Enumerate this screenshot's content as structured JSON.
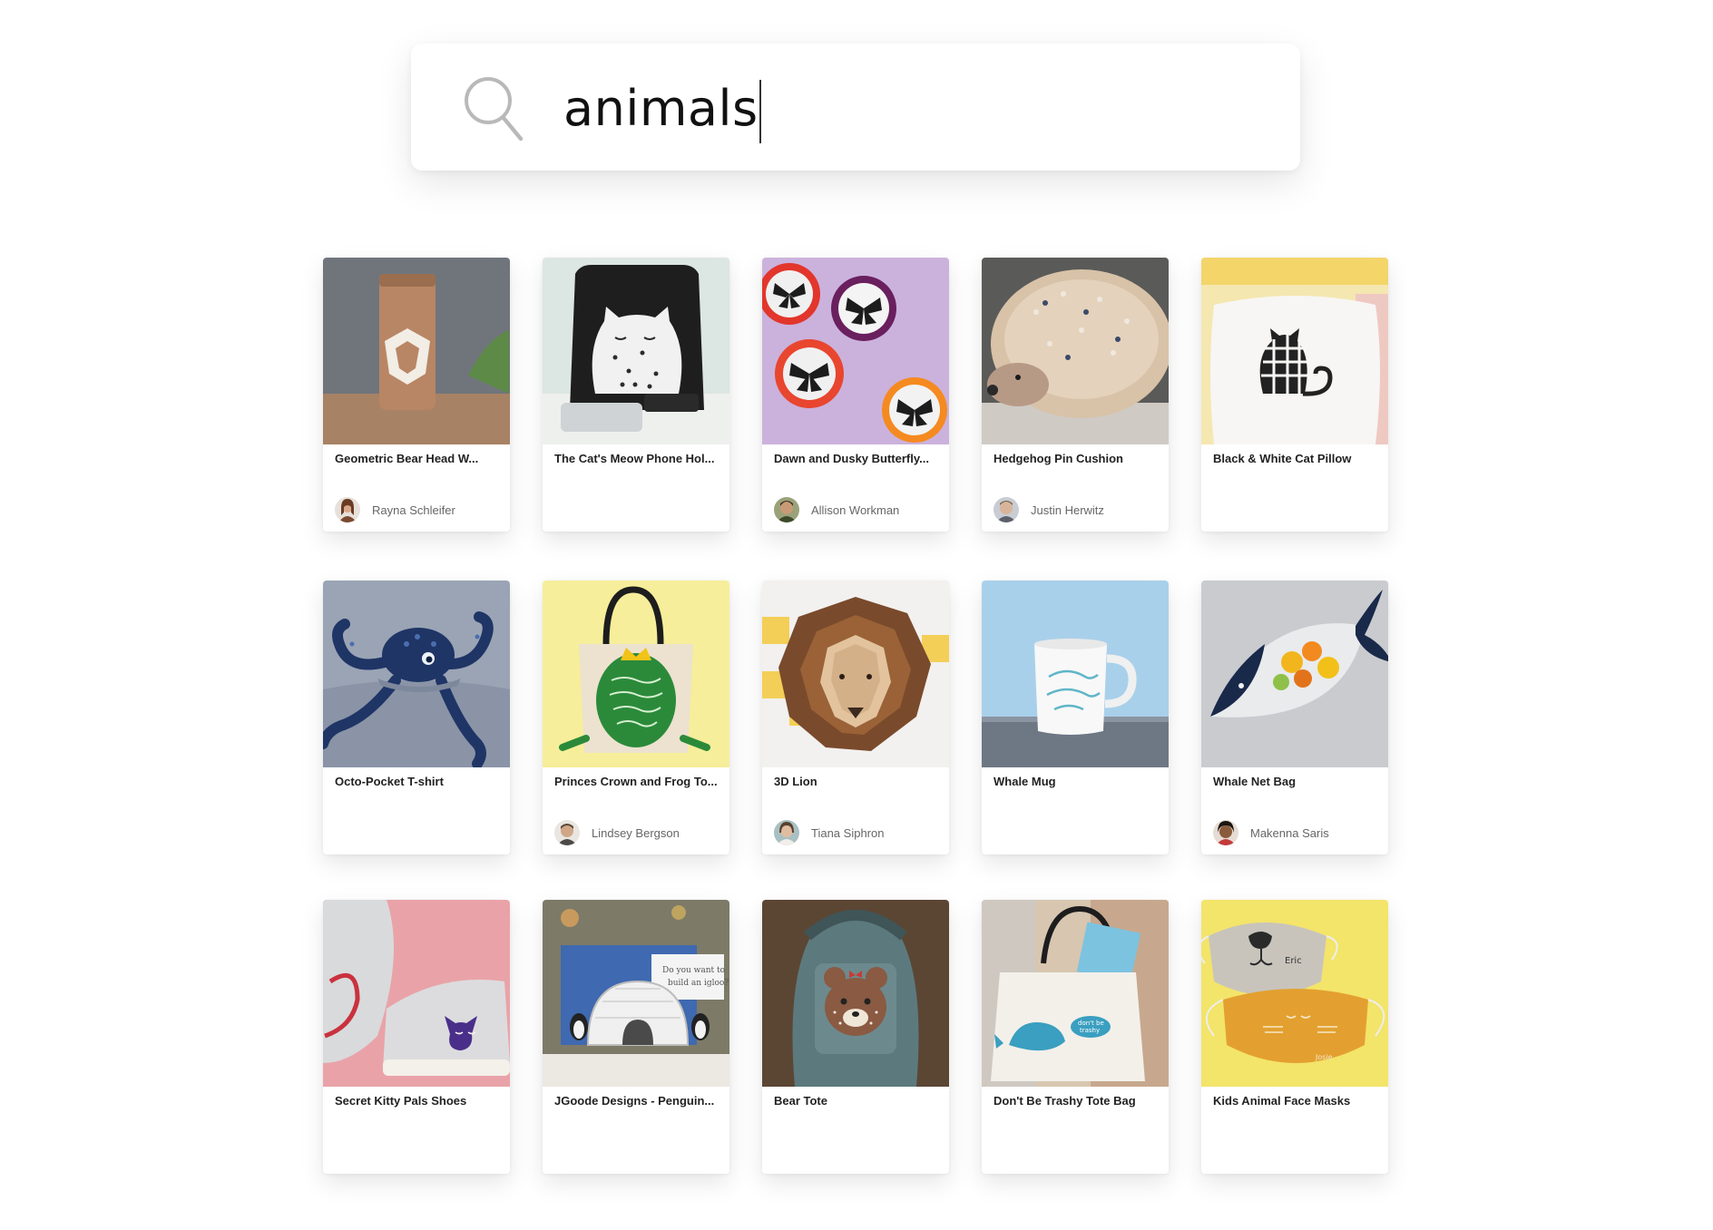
{
  "search": {
    "query": "animals"
  },
  "projects": [
    {
      "title": "Geometric Bear Head W...",
      "author": "Rayna Schleifer",
      "avatar_color": "#7a4a32"
    },
    {
      "title": "The Cat's Meow Phone Hol...",
      "author": ""
    },
    {
      "title": "Dawn and Dusky Butterfly...",
      "author": "Allison Workman",
      "avatar_color": "#5a6b3a"
    },
    {
      "title": "Hedgehog Pin Cushion",
      "author": "Justin Herwitz",
      "avatar_color": "#8a8f99"
    },
    {
      "title": "Black & White Cat Pillow",
      "author": ""
    },
    {
      "title": "Octo-Pocket T-shirt",
      "author": ""
    },
    {
      "title": "Princes Crown and Frog To...",
      "author": "Lindsey Bergson",
      "avatar_color": "#6b5848"
    },
    {
      "title": "3D Lion",
      "author": "Tiana Siphron",
      "avatar_color": "#7c6a5a"
    },
    {
      "title": "Whale Mug",
      "author": ""
    },
    {
      "title": "Whale Net Bag",
      "author": "Makenna Saris",
      "avatar_color": "#4a3428"
    },
    {
      "title": "Secret Kitty Pals Shoes",
      "author": ""
    },
    {
      "title": "JGoode Designs - Penguin...",
      "author": ""
    },
    {
      "title": "Bear Tote",
      "author": ""
    },
    {
      "title": "Don't Be Trashy Tote Bag",
      "author": ""
    },
    {
      "title": "Kids Animal Face Masks",
      "author": ""
    }
  ]
}
